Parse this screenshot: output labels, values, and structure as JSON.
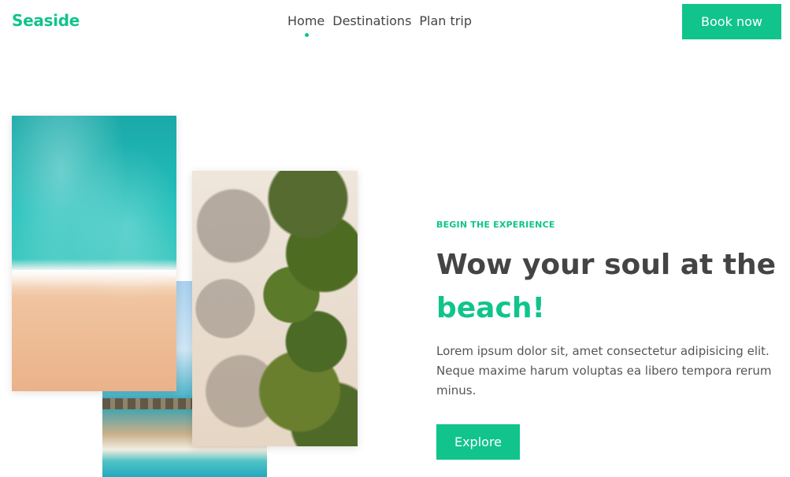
{
  "brand": {
    "logo_text": "Seaside",
    "accent_color": "#10c48b"
  },
  "nav": {
    "items": [
      {
        "label": "Home",
        "active": true
      },
      {
        "label": "Destinations",
        "active": false
      },
      {
        "label": "Plan trip",
        "active": false
      }
    ]
  },
  "header": {
    "cta_label": "Book now"
  },
  "hero": {
    "eyebrow": "BEGIN THE EXPERIENCE",
    "title_main": "Wow your soul at the",
    "title_accent": "beach!",
    "description": "Lorem ipsum dolor sit, amet consectetur adipisicing elit. Neque maxime harum voluptas ea libero tempora rerum minus.",
    "cta_label": "Explore"
  }
}
